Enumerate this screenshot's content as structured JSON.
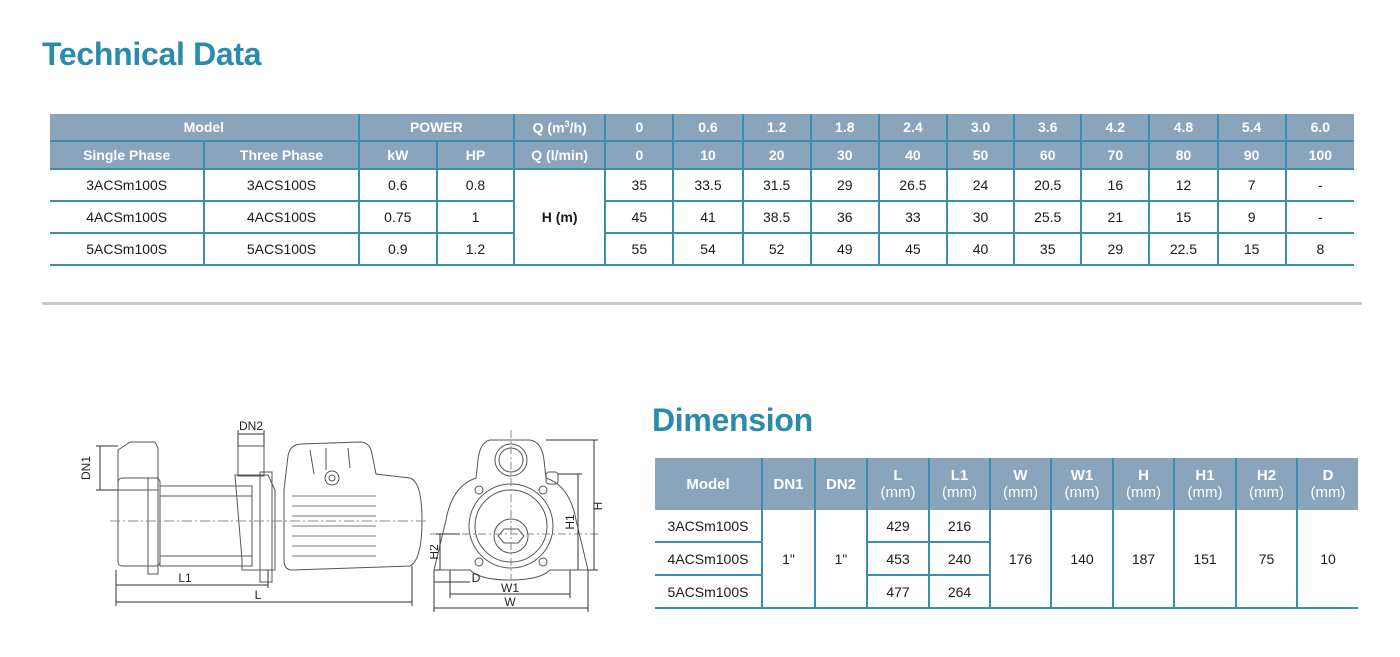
{
  "technical_data": {
    "title": "Technical Data",
    "header": {
      "model": "Model",
      "single_phase": "Single Phase",
      "three_phase": "Three Phase",
      "power": "POWER",
      "kw": "kW",
      "hp": "HP",
      "q_m3h_prefix": "Q (m",
      "q_m3h_sup": "3",
      "q_m3h_suffix": "/h)",
      "q_lmin": "Q (l/min)",
      "h_label": "H (m)"
    },
    "q_m3h": [
      "0",
      "0.6",
      "1.2",
      "1.8",
      "2.4",
      "3.0",
      "3.6",
      "4.2",
      "4.8",
      "5.4",
      "6.0"
    ],
    "q_lmin": [
      "0",
      "10",
      "20",
      "30",
      "40",
      "50",
      "60",
      "70",
      "80",
      "90",
      "100"
    ],
    "rows": [
      {
        "single_phase": "3ACSm100S",
        "three_phase": "3ACS100S",
        "kw": "0.6",
        "hp": "0.8",
        "head": [
          "35",
          "33.5",
          "31.5",
          "29",
          "26.5",
          "24",
          "20.5",
          "16",
          "12",
          "7",
          "-"
        ]
      },
      {
        "single_phase": "4ACSm100S",
        "three_phase": "4ACS100S",
        "kw": "0.75",
        "hp": "1",
        "head": [
          "45",
          "41",
          "38.5",
          "36",
          "33",
          "30",
          "25.5",
          "21",
          "15",
          "9",
          "-"
        ]
      },
      {
        "single_phase": "5ACSm100S",
        "three_phase": "5ACS100S",
        "kw": "0.9",
        "hp": "1.2",
        "head": [
          "55",
          "54",
          "52",
          "49",
          "45",
          "40",
          "35",
          "29",
          "22.5",
          "15",
          "8"
        ]
      }
    ]
  },
  "dimension": {
    "title": "Dimension",
    "headers": [
      {
        "key": "model",
        "label": "Model",
        "unit": ""
      },
      {
        "key": "dn1",
        "label": "DN1",
        "unit": ""
      },
      {
        "key": "dn2",
        "label": "DN2",
        "unit": ""
      },
      {
        "key": "l",
        "label": "L",
        "unit": "(mm)"
      },
      {
        "key": "l1",
        "label": "L1",
        "unit": "(mm)"
      },
      {
        "key": "w",
        "label": "W",
        "unit": "(mm)"
      },
      {
        "key": "w1",
        "label": "W1",
        "unit": "(mm)"
      },
      {
        "key": "h",
        "label": "H",
        "unit": "(mm)"
      },
      {
        "key": "h1",
        "label": "H1",
        "unit": "(mm)"
      },
      {
        "key": "h2",
        "label": "H2",
        "unit": "(mm)"
      },
      {
        "key": "d",
        "label": "D",
        "unit": "(mm)"
      }
    ],
    "models": [
      "3ACSm100S",
      "4ACSm100S",
      "5ACSm100S"
    ],
    "l": [
      "429",
      "453",
      "477"
    ],
    "l1": [
      "216",
      "240",
      "264"
    ],
    "shared": {
      "dn1": "1\"",
      "dn2": "1\"",
      "w": "176",
      "w1": "140",
      "h": "187",
      "h1": "151",
      "h2": "75",
      "d": "10"
    }
  },
  "drawing_labels": {
    "side": {
      "dn1": "DN1",
      "dn2": "DN2",
      "l1": "L1",
      "l": "L"
    },
    "front": {
      "h": "H",
      "h1": "H1",
      "h2": "H2",
      "d": "D",
      "w1": "W1",
      "w": "W"
    }
  }
}
